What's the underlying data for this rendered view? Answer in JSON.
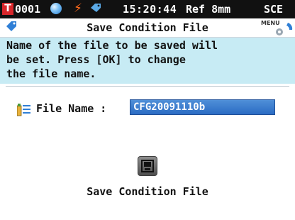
{
  "status": {
    "t_badge": "T",
    "sample_number": "0001",
    "time": "15:20:44",
    "measurement": "Ref 8mm",
    "mode": "SCE",
    "icons": [
      "blue-ball-icon",
      "lightning-icon",
      "tag-icon"
    ],
    "colors": {
      "bar": "#111111",
      "t_badge": "#d8262b",
      "bolt": "#ff6a1a",
      "ball": "#2a7fd0"
    }
  },
  "title_bar": {
    "title": "Save Condition File",
    "menu_label": "MENU",
    "icons": [
      "tag-icon",
      "menu-gear-icon"
    ]
  },
  "instructions": {
    "lines": [
      "Name of the file to be saved will",
      "be set. Press [OK] to change",
      "the file name."
    ],
    "background": "#c7ebf4"
  },
  "file_name": {
    "label": "File Name :",
    "value": "CFG20091110b",
    "icon": "file-list-icon",
    "field_color": "#2b6cc4"
  },
  "save": {
    "icon": "save-disk-icon",
    "label": "Save Condition File"
  }
}
